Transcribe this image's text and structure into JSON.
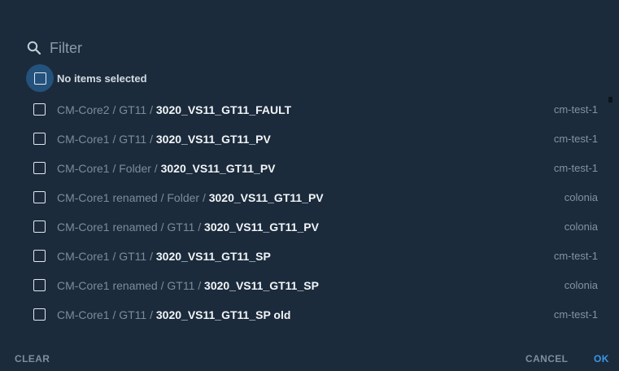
{
  "filter": {
    "icon": "search-icon",
    "placeholder": "Filter"
  },
  "select_all": {
    "label": "No items selected",
    "checked": false
  },
  "items": [
    {
      "path": "CM-Core2 / GT11 / ",
      "name": "3020_VS11_GT11_FAULT",
      "source": "cm-test-1",
      "checked": false
    },
    {
      "path": "CM-Core1 / GT11 / ",
      "name": "3020_VS11_GT11_PV",
      "source": "cm-test-1",
      "checked": false
    },
    {
      "path": "CM-Core1 / Folder / ",
      "name": "3020_VS11_GT11_PV",
      "source": "cm-test-1",
      "checked": false
    },
    {
      "path": "CM-Core1 renamed / Folder / ",
      "name": "3020_VS11_GT11_PV",
      "source": "colonia",
      "checked": false
    },
    {
      "path": "CM-Core1 renamed / GT11 / ",
      "name": "3020_VS11_GT11_PV",
      "source": "colonia",
      "checked": false
    },
    {
      "path": "CM-Core1 / GT11 / ",
      "name": "3020_VS11_GT11_SP",
      "source": "cm-test-1",
      "checked": false
    },
    {
      "path": "CM-Core1 renamed / GT11 / ",
      "name": "3020_VS11_GT11_SP",
      "source": "colonia",
      "checked": false
    },
    {
      "path": "CM-Core1 / GT11 / ",
      "name": "3020_VS11_GT11_SP old",
      "source": "cm-test-1",
      "checked": false
    }
  ],
  "footer": {
    "clear_label": "CLEAR",
    "cancel_label": "CANCEL",
    "ok_label": "OK"
  },
  "colors": {
    "background": "#1b2b3c",
    "accent": "#3b97e3",
    "focus_halo": "#24527d"
  }
}
